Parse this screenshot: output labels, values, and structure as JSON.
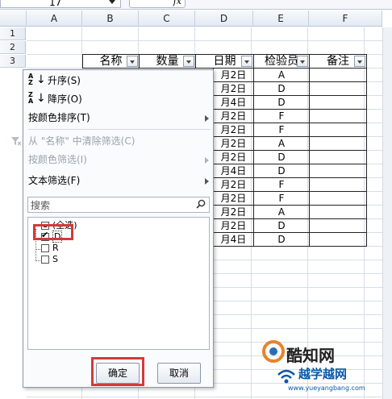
{
  "formula_bar": {
    "name_box": "17",
    "fx_label": "fx"
  },
  "columns": [
    "A",
    "B",
    "C",
    "D",
    "E",
    "F"
  ],
  "rows": [
    "1",
    "2",
    "3"
  ],
  "table": {
    "headers": [
      "名称",
      "数量",
      "日期",
      "检验员",
      "备注"
    ],
    "dates": [
      "月2日",
      "月2日",
      "月4日",
      "月2日",
      "月2日",
      "月2日",
      "月2日",
      "月4日",
      "月2日",
      "月2日",
      "月2日",
      "月2日",
      "月4日"
    ],
    "inspectors": [
      "A",
      "D",
      "D",
      "F",
      "F",
      "A",
      "D",
      "D",
      "F",
      "F",
      "A",
      "D",
      "D"
    ]
  },
  "filter_menu": {
    "sort_asc": "升序(S)",
    "sort_desc": "降序(O)",
    "sort_by_color": "按颜色排序(T)",
    "clear_filter": "从 \"名称\" 中清除筛选(C)",
    "filter_by_color": "按颜色筛选(I)",
    "text_filter": "文本筛选(F)",
    "search_placeholder": "搜索",
    "items": [
      {
        "label": "(全选)",
        "state": "partial"
      },
      {
        "label": "D",
        "state": "checked"
      },
      {
        "label": "R",
        "state": "unchecked"
      },
      {
        "label": "S",
        "state": "unchecked"
      }
    ],
    "ok": "确定",
    "cancel": "取消"
  },
  "watermark": {
    "brand": "酷知网",
    "site": "越学越网",
    "url": "www.yueyangbang.com"
  },
  "colors": {
    "highlight": "#d23a3a",
    "grid": "#d7dde6"
  }
}
